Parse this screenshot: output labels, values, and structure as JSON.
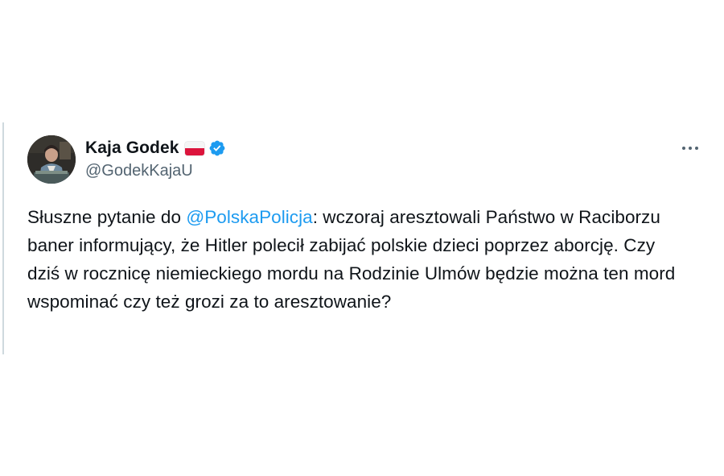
{
  "tweet": {
    "author": {
      "display_name": "Kaja Godek",
      "handle": "@GodekKajaU",
      "flag_icon": "poland-flag-icon",
      "verified_icon": "verified-badge-icon",
      "verified_color": "#1d9bf0"
    },
    "more_icon": "more-options-icon",
    "text": {
      "before_mention": "Słuszne pytanie do ",
      "mention": "@PolskaPolicja",
      "after_mention": ": wczoraj aresztowali Państwo w Raciborzu baner informujący, że Hitler polecił zabijać polskie dzieci poprzez aborcję. Czy dziś w rocznicę niemieckiego mordu na Rodzinie Ulmów będzie można ten mord wspominać czy też grozi za to aresztowanie?"
    },
    "colors": {
      "text": "#0f1419",
      "secondary": "#536471",
      "link": "#1d9bf0"
    }
  }
}
